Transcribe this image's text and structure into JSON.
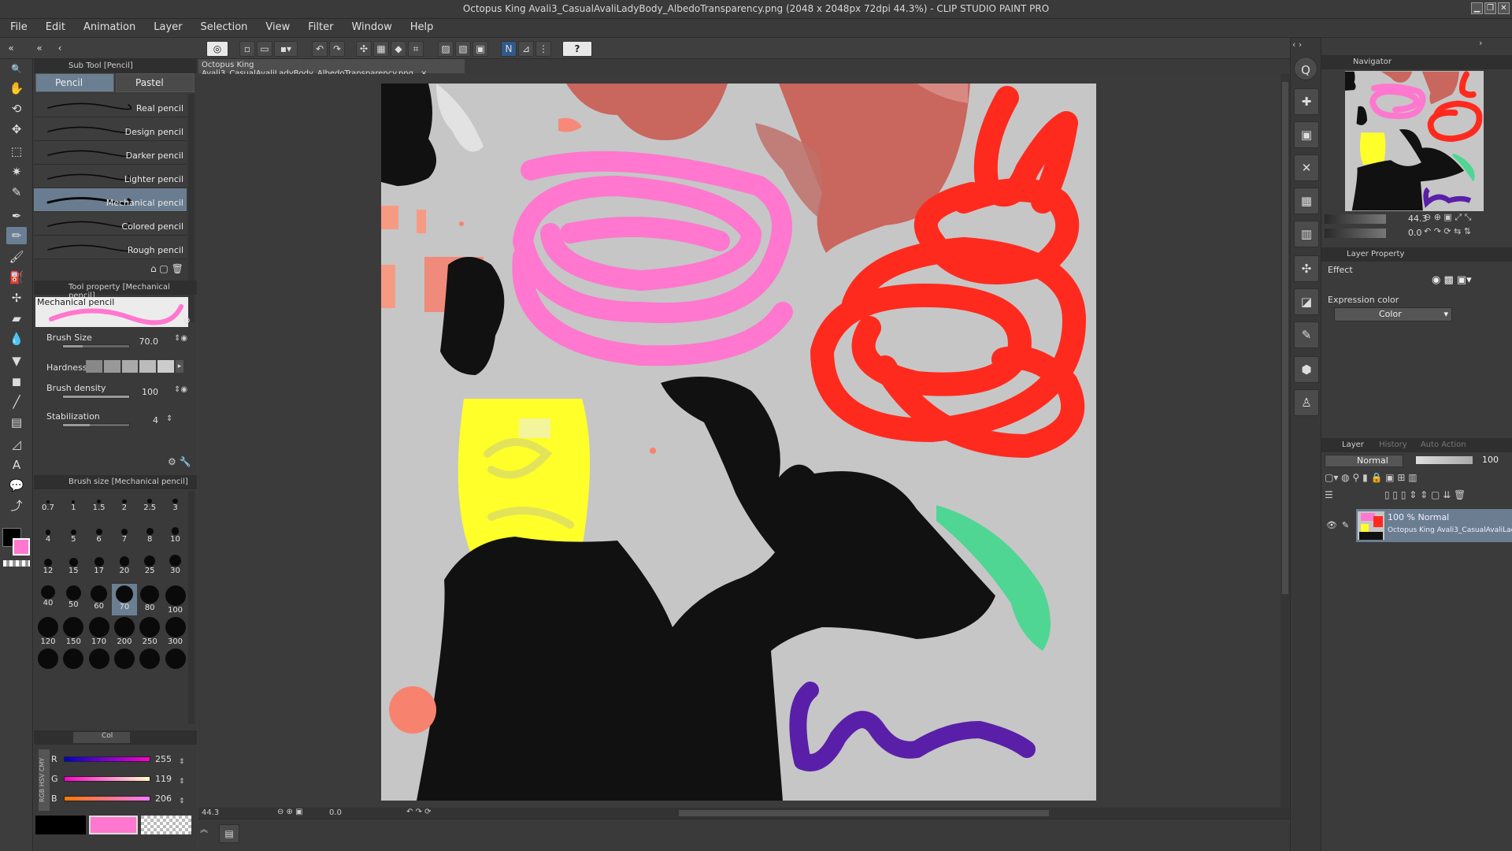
{
  "window": {
    "title": "Octopus King Avali3_CasualAvaliLadyBody_AlbedoTransparency.png (2048 x 2048px 72dpi 44.3%)  - CLIP STUDIO PAINT PRO",
    "controls": [
      "▁",
      "❐",
      "✕"
    ]
  },
  "menu": [
    "File",
    "Edit",
    "Animation",
    "Layer",
    "Selection",
    "View",
    "Filter",
    "Window",
    "Help"
  ],
  "subtool": {
    "header": "Sub Tool [Pencil]",
    "tabs": [
      "Pencil",
      "Pastel"
    ],
    "brushes": [
      "Real pencil",
      "Design pencil",
      "Darker pencil",
      "Lighter pencil",
      "Mechanical pencil",
      "Colored pencil",
      "Rough pencil"
    ],
    "selected_index": 4
  },
  "tool_property": {
    "header": "Tool property [Mechanical pencil]",
    "preview_label": "Mechanical pencil",
    "brush_size_label": "Brush Size",
    "brush_size_value": "70.0",
    "hardness_label": "Hardness",
    "density_label": "Brush density",
    "density_value": "100",
    "stabilization_label": "Stabilization",
    "stabilization_value": "4"
  },
  "brush_size_panel": {
    "header": "Brush size [Mechanical pencil]",
    "sizes": [
      "0.7",
      "1",
      "1.5",
      "2",
      "2.5",
      "3",
      "4",
      "5",
      "6",
      "7",
      "8",
      "10",
      "12",
      "15",
      "17",
      "20",
      "25",
      "30",
      "40",
      "50",
      "60",
      "70",
      "80",
      "100",
      "120",
      "150",
      "170",
      "200",
      "250",
      "300"
    ],
    "selected": "70"
  },
  "color_panel": {
    "tab": "Col",
    "side_labels": [
      "RGB",
      "HSV",
      "CMY"
    ],
    "channels": [
      {
        "label": "R",
        "value": "255",
        "fill": 1.0
      },
      {
        "label": "G",
        "value": "119",
        "fill": 0.47
      },
      {
        "label": "B",
        "value": "206",
        "fill": 0.81
      }
    ],
    "main_color": "#000000",
    "sub_color": "#ff77ce"
  },
  "document": {
    "tab_label": "Octopus King Avali3_CasualAvaliLadyBody_AlbedoTransparency.png",
    "close": "×"
  },
  "status": {
    "zoom": "44.3",
    "angle": "0.0"
  },
  "navigator": {
    "header": "Navigator",
    "zoom": "44.3",
    "rotation": "0.0"
  },
  "layer_property": {
    "header": "Layer Property",
    "effect_label": "Effect",
    "expression_label": "Expression color",
    "expression_value": "Color"
  },
  "layer_panel": {
    "tabs": [
      "Layer",
      "History",
      "Auto Action"
    ],
    "blend_mode": "Normal",
    "opacity": "100",
    "layers": [
      {
        "mode": "100 % Normal",
        "name": "Octopus King Avali3_CasualAvaliLad"
      }
    ]
  },
  "colors": {
    "accent_selected": "#6b7f93",
    "canvas_bg": "#c6c6c6",
    "pink": "#ff77ce",
    "red": "#ff2a1e",
    "yellow": "#ffff2a",
    "green": "#4fd693",
    "purple": "#5a1fa8",
    "brown": "#c9665d"
  },
  "icons": {
    "tools": [
      "zoom-icon",
      "hand-icon",
      "rotate-icon",
      "move-icon",
      "marquee-icon",
      "lasso-icon",
      "eyedropper-icon",
      "pen-icon",
      "pencil-icon",
      "brush-icon",
      "airbrush-icon",
      "decoration-icon",
      "eraser-icon",
      "blend-icon",
      "fill-icon",
      "gradient-icon",
      "figure-icon",
      "frame-icon",
      "ruler-icon",
      "text-icon",
      "balloon-icon",
      "correct-line-icon"
    ]
  }
}
